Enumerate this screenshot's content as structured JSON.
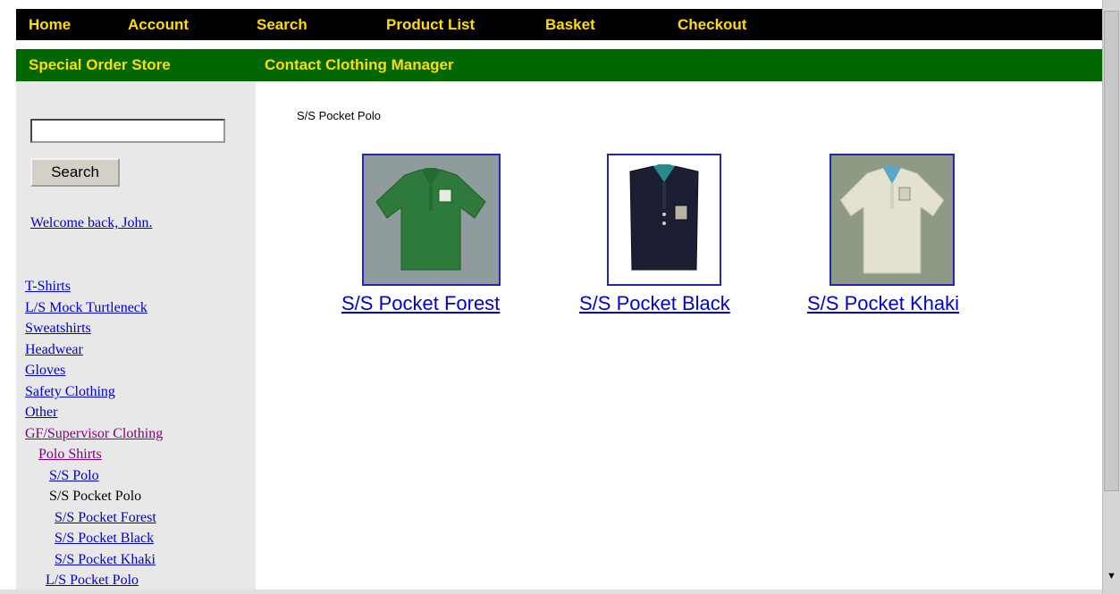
{
  "nav_top": [
    "Home",
    "Account",
    "Search",
    "Product List",
    "Basket",
    "Checkout"
  ],
  "nav_second": [
    "Special Order Store",
    "Contact Clothing Manager"
  ],
  "sidebar": {
    "search_value": "",
    "search_button": "Search",
    "welcome": "Welcome back, John.",
    "categories": [
      "T-Shirts",
      "L/S Mock Turtleneck",
      "Sweatshirts",
      "Headwear",
      "Gloves",
      "Safety Clothing",
      "Other"
    ],
    "gf_supervisor": "GF/Supervisor Clothing",
    "polo_shirts": "Polo Shirts",
    "ss_polo": "S/S Polo",
    "ss_pocket_polo": "S/S Pocket Polo",
    "subitems": [
      "S/S Pocket Forest",
      "S/S Pocket Black",
      "S/S Pocket Khaki"
    ],
    "ls_pocket_polo": "L/S Pocket Polo"
  },
  "main": {
    "heading": "S/S Pocket Polo",
    "products": [
      {
        "label": "S/S Pocket Forest",
        "shirt_color": "#2e7a3a",
        "bg_color": "#9aa3a6"
      },
      {
        "label": "S/S Pocket Black",
        "shirt_color": "#1c1f33",
        "bg_color": "#ffffff"
      },
      {
        "label": "S/S Pocket Khaki",
        "shirt_color": "#e3e1cf",
        "bg_color": "#8d9a86"
      }
    ]
  },
  "colors": {
    "nav_text": "#ffdd00",
    "top_bar": "#000000",
    "second_bar": "#006600",
    "sidebar_bg": "#e8e8e8",
    "link": "#0000cc",
    "visited_link": "#800080"
  }
}
